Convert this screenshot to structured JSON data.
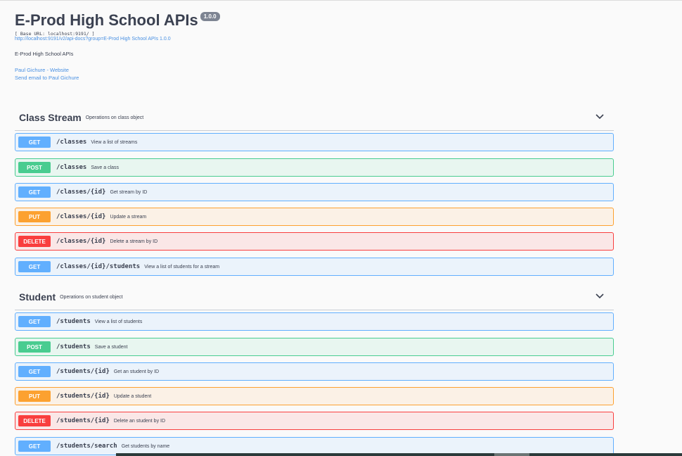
{
  "info": {
    "title": "E-Prod High School APIs",
    "version": "1.0.0",
    "base_url": "[ Base URL: localhost:9191/ ]",
    "docs_link": "http://localhost:9191/v2/api-docs?group=E-Prod High School APIs 1.0.0",
    "description": "E-Prod High School APIs",
    "contact_website": "Paul Gichure - Website",
    "contact_email": "Send email to Paul Gichure"
  },
  "tags": [
    {
      "name": "Class Stream",
      "description": "Operations on class object",
      "operations": [
        {
          "method": "GET",
          "path": "/classes",
          "summary": "View a list of streams"
        },
        {
          "method": "POST",
          "path": "/classes",
          "summary": "Save a class"
        },
        {
          "method": "GET",
          "path": "/classes/{id}",
          "summary": "Get stream by ID"
        },
        {
          "method": "PUT",
          "path": "/classes/{id}",
          "summary": "Update a stream"
        },
        {
          "method": "DELETE",
          "path": "/classes/{id}",
          "summary": "Delete a stream by ID"
        },
        {
          "method": "GET",
          "path": "/classes/{id}/students",
          "summary": "View a list of students for a stream"
        }
      ]
    },
    {
      "name": "Student",
      "description": "Operations on student object",
      "operations": [
        {
          "method": "GET",
          "path": "/students",
          "summary": "View a list of students"
        },
        {
          "method": "POST",
          "path": "/students",
          "summary": "Save a student"
        },
        {
          "method": "GET",
          "path": "/students/{id}",
          "summary": "Get an student by ID"
        },
        {
          "method": "PUT",
          "path": "/students/{id}",
          "summary": "Update a student"
        },
        {
          "method": "DELETE",
          "path": "/students/{id}",
          "summary": "Delete an student by ID"
        },
        {
          "method": "GET",
          "path": "/students/search",
          "summary": "Get students by name"
        }
      ]
    }
  ],
  "colors": {
    "get": "#61affe",
    "post": "#49cc90",
    "put": "#fca130",
    "delete": "#f93e3e",
    "link": "#4990e2"
  },
  "icons": {
    "tag_toggle": "chevron-down-icon"
  }
}
